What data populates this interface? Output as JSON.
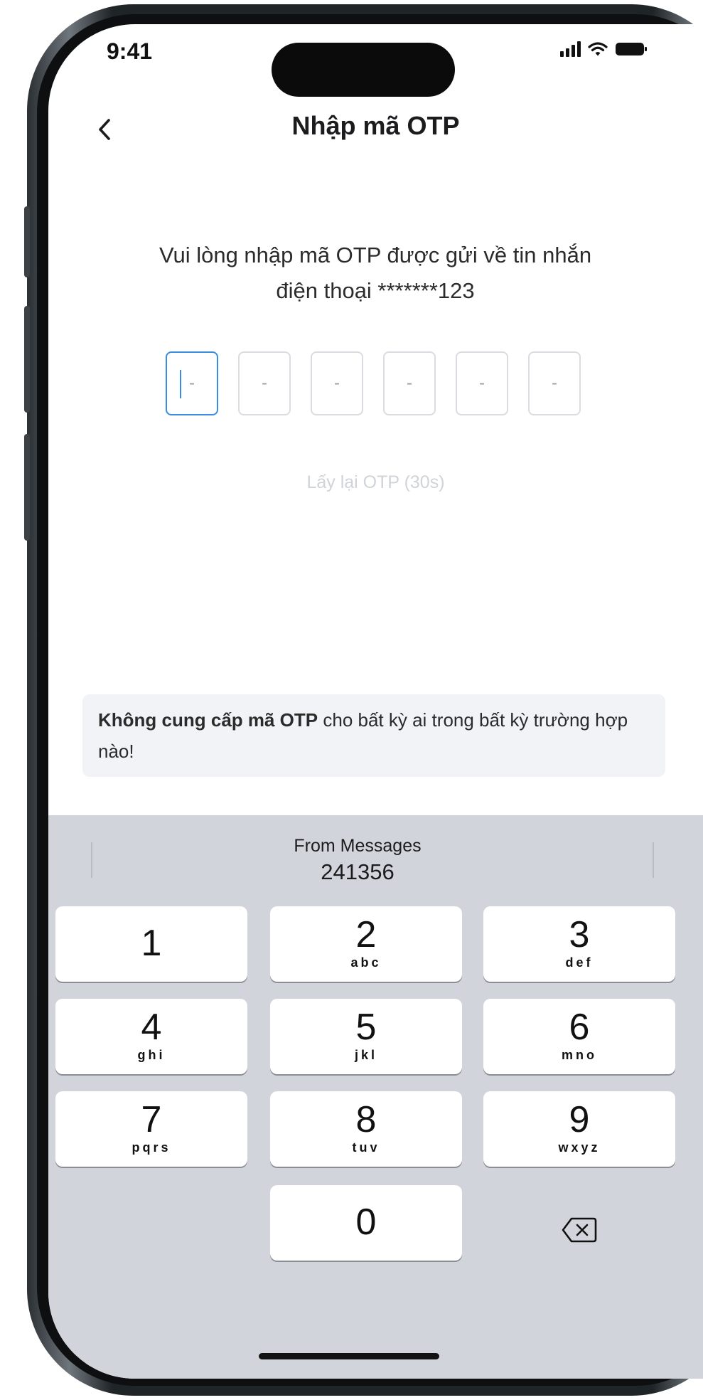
{
  "status_bar": {
    "time": "9:41"
  },
  "header": {
    "title": "Nhập mã OTP"
  },
  "otp": {
    "instruction_line1": "Vui lòng nhập mã OTP được gửi về tin nhắn",
    "instruction_line2": "điện thoại *******123",
    "boxes": [
      "-",
      "-",
      "-",
      "-",
      "-",
      "-"
    ],
    "resend": "Lấy lại OTP (30s)"
  },
  "warning": {
    "bold": "Không cung cấp mã OTP",
    "rest": " cho bất kỳ ai trong bất kỳ trường hợp nào!"
  },
  "keyboard": {
    "suggestion_source": "From Messages",
    "suggestion_code": "241356",
    "keys": [
      {
        "num": "1",
        "letters": ""
      },
      {
        "num": "2",
        "letters": "abc"
      },
      {
        "num": "3",
        "letters": "def"
      },
      {
        "num": "4",
        "letters": "ghi"
      },
      {
        "num": "5",
        "letters": "jkl"
      },
      {
        "num": "6",
        "letters": "mno"
      },
      {
        "num": "7",
        "letters": "pqrs"
      },
      {
        "num": "8",
        "letters": "tuv"
      },
      {
        "num": "9",
        "letters": "wxyz"
      },
      {
        "num": "0",
        "letters": ""
      }
    ]
  },
  "icons": {
    "back": "chevron-left-icon",
    "backspace": "backspace-icon",
    "signal": "signal-icon",
    "wifi": "wifi-icon",
    "battery": "battery-icon"
  }
}
